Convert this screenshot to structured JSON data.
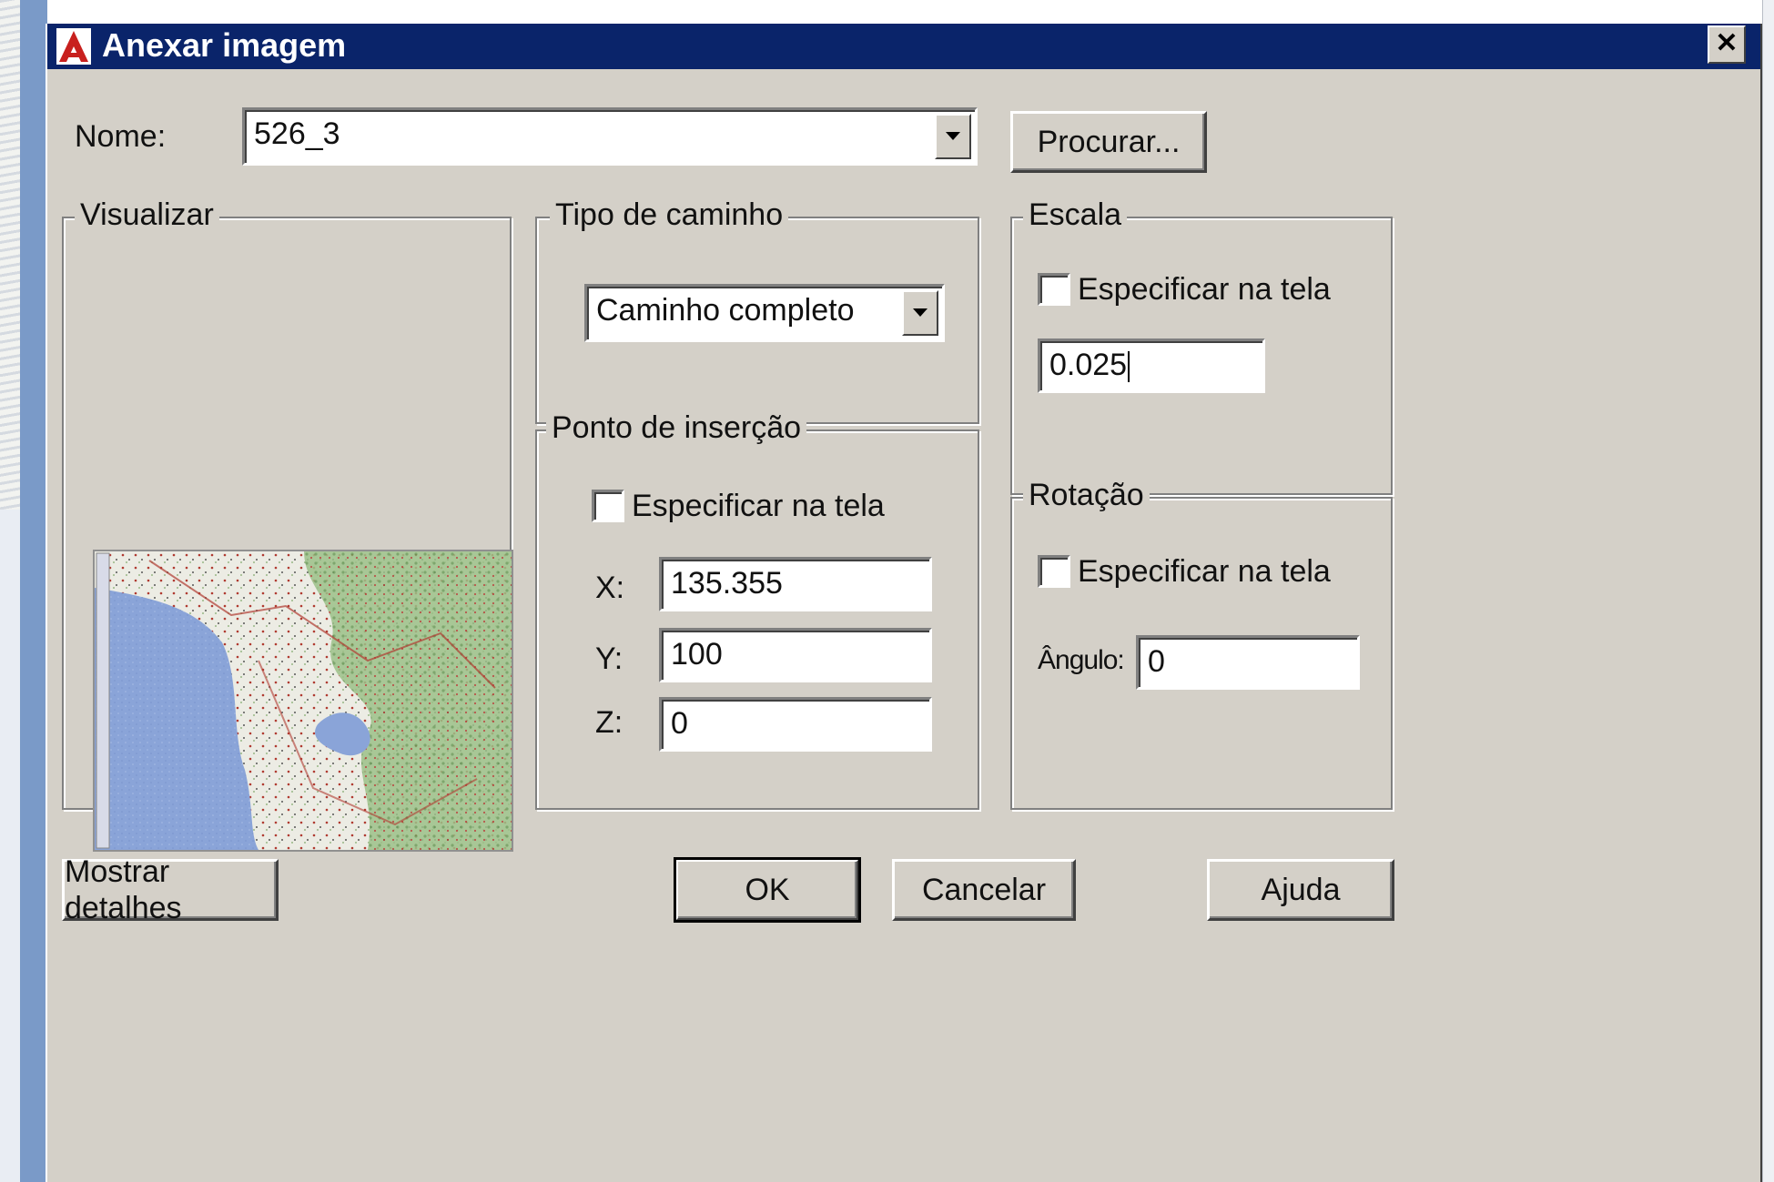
{
  "window": {
    "title": "Anexar imagem",
    "close_glyph": "✕"
  },
  "name_field": {
    "label": "Nome:",
    "value": "526_3"
  },
  "browse_button": "Procurar...",
  "preview_group": {
    "label": "Visualizar",
    "image_colors": {
      "sea": "#8aa4d8",
      "land": "#ecece4",
      "forest": "#7fa86a",
      "roads": "#b03a30",
      "water_dark": "#5f7fc4"
    }
  },
  "path_type_group": {
    "label": "Tipo de caminho",
    "selected": "Caminho completo"
  },
  "insertion_group": {
    "label": "Ponto de inserção",
    "specify_on_screen": "Especificar na tela",
    "x_label": "X:",
    "x_value": "135.355",
    "y_label": "Y:",
    "y_value": "100",
    "z_label": "Z:",
    "z_value": "0"
  },
  "scale_group": {
    "label": "Escala",
    "specify_on_screen": "Especificar na tela",
    "value": "0.025"
  },
  "rotation_group": {
    "label": "Rotação",
    "specify_on_screen": "Especificar na tela",
    "angle_label": "Ângulo:",
    "angle_value": "0"
  },
  "buttons": {
    "details": "Mostrar detalhes",
    "ok": "OK",
    "cancel": "Cancelar",
    "help": "Ajuda"
  },
  "colors": {
    "titlebar": "#0a246a",
    "dialog_face": "#d4d0c8",
    "app_icon_red": "#c8201e"
  }
}
